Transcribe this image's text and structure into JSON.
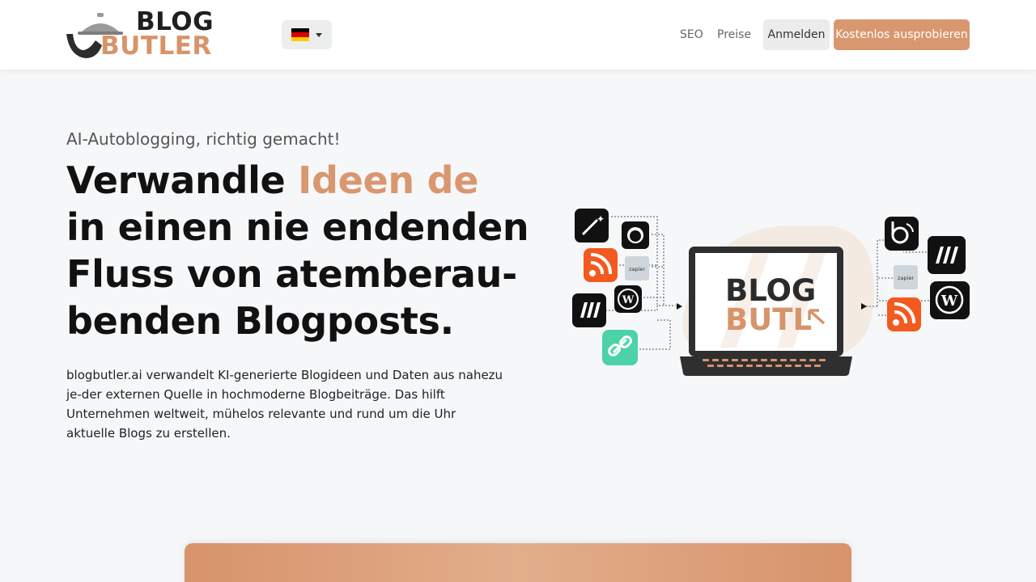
{
  "brand": {
    "logo_line1": "BLOG",
    "logo_line2": "BUTLER",
    "accent_color": "#d99770"
  },
  "header": {
    "language_flag": "german-flag-icon",
    "nav": {
      "seo": "SEO",
      "preise": "Preise",
      "login": "Anmelden",
      "cta": "Kostenlos ausprobieren"
    }
  },
  "hero": {
    "eyebrow": "AI-Autoblogging, richtig gemacht!",
    "headline_start": "Verwandle ",
    "headline_accent": "Ideen de",
    "headline_rest": "in einen nie endenden Fluss von atemberau-benden Blogposts.",
    "description": "blogbutler.ai verwandelt KI-generierte Blogideen und Daten aus nahezu je-der externen Quelle in hochmoderne Blogbeiträge. Das hilft Unternehmen weltweit, mühelos relevante und rund um die Uhr aktuelle Blogs zu erstellen."
  },
  "illustration": {
    "laptop_logo_line1": "BLOG",
    "laptop_logo_line2": "BUTL",
    "input_icons": [
      "magic-wand-icon",
      "github-icon",
      "rss-icon",
      "zapier-icon",
      "wordpress-icon",
      "make-icon",
      "link-icon"
    ],
    "output_icons": [
      "blogbutler-icon",
      "make-icon",
      "zapier-icon",
      "wordpress-icon",
      "rss-icon"
    ],
    "zapier_label": "zapier"
  }
}
